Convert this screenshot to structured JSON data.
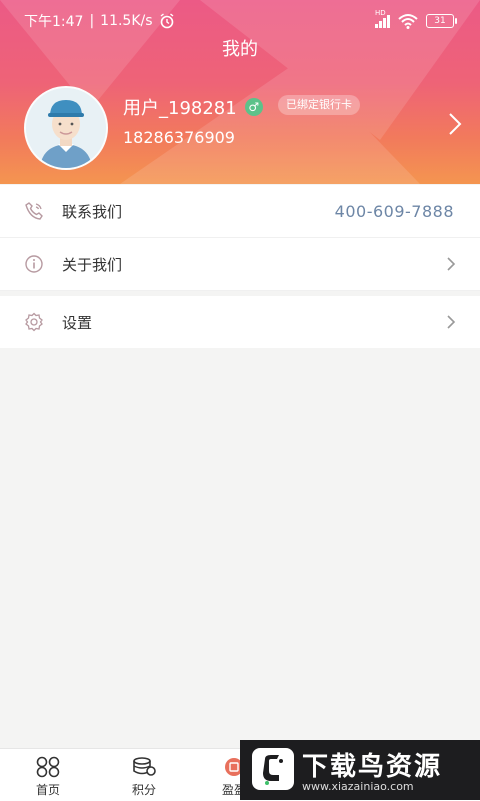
{
  "status_bar": {
    "time": "下午1:47",
    "net_speed": "11.5K/s",
    "separator": "|",
    "battery": "31",
    "hd_label": "HD"
  },
  "page": {
    "title": "我的"
  },
  "profile": {
    "username": "用户_198281",
    "gender_symbol": "♂",
    "badge": "已绑定银行卡",
    "phone": "18286376909"
  },
  "menu": {
    "contact": {
      "label": "联系我们",
      "value": "400-609-7888",
      "icon": "phone-icon"
    },
    "about": {
      "label": "关于我们",
      "icon": "info-icon"
    },
    "settings": {
      "label": "设置",
      "icon": "gear-icon"
    }
  },
  "tabbar": {
    "tabs": [
      {
        "label": "首页",
        "icon": "home-grid-icon"
      },
      {
        "label": "积分",
        "icon": "coins-icon"
      },
      {
        "label": "盈盈",
        "icon": "badge-icon"
      }
    ]
  },
  "watermark": {
    "title": "下载鸟资源",
    "url": "www.xiazainiao.com"
  },
  "colors": {
    "header_top": "#ec5a86",
    "header_bottom": "#f49550",
    "phone_number": "#6d86a6",
    "gender_badge": "#5cc28a"
  }
}
